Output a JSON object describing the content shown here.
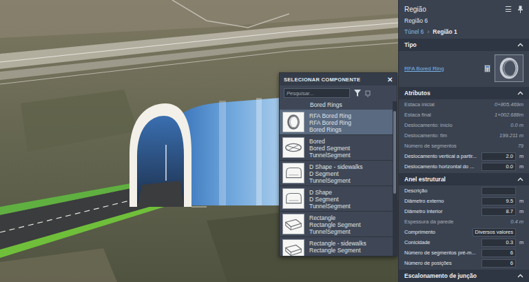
{
  "popup": {
    "title": "SELECIONAR COMPONENTE",
    "close": "✕",
    "search": {
      "placeholder": "Pesquisar..."
    },
    "items": [
      {
        "lines": [
          "Bored Rings"
        ],
        "selected": false,
        "kind": "partial"
      },
      {
        "lines": [
          "RFA Bored Ring",
          "RFA Bored Ring",
          "Bored Rings"
        ],
        "selected": true,
        "kind": "ring"
      },
      {
        "lines": [
          "Bored",
          "Bored Segment",
          "TunnelSegment"
        ],
        "selected": false,
        "kind": "bored"
      },
      {
        "lines": [
          "D Shape - sidewalks",
          "D Segment",
          "TunnelSegment"
        ],
        "selected": false,
        "kind": "dshape"
      },
      {
        "lines": [
          "D Shape",
          "D Segment",
          "TunnelSegment"
        ],
        "selected": false,
        "kind": "dshape"
      },
      {
        "lines": [
          "Rectangle",
          "Rectangle Segment",
          "TunnelSegment"
        ],
        "selected": false,
        "kind": "rect"
      },
      {
        "lines": [
          "Rectangle - sidewalks",
          "Rectangle Segment"
        ],
        "selected": false,
        "kind": "rect"
      }
    ]
  },
  "panel": {
    "title": "Região",
    "menu": "☰",
    "subtitle": "Região 6",
    "breadcrumb": [
      {
        "label": "Túnel 6",
        "selected": false
      },
      {
        "label": "Região 1",
        "selected": true
      }
    ],
    "separator": "›",
    "type_section": {
      "title": "Tipo",
      "expanded": true,
      "link": "RFA Bored Ring"
    },
    "sections": [
      {
        "title": "Atributos",
        "expanded": true,
        "rows": [
          {
            "label": "Estaca inicial",
            "value": "0+805.469m",
            "kind": "readonly"
          },
          {
            "label": "Estaca final",
            "value": "1+002.688m",
            "kind": "readonly"
          },
          {
            "label": "Deslocamento: início",
            "value": "0.0 m",
            "kind": "readonly"
          },
          {
            "label": "Deslocamento: fim",
            "value": "199.211 m",
            "kind": "readonly"
          },
          {
            "label": "Número de segmentos",
            "value": "79",
            "kind": "readonly"
          },
          {
            "label": "Deslocamento vertical a partir...",
            "value": "2.0",
            "unit": "m",
            "kind": "input"
          },
          {
            "label": "Deslocamento horizontal do ...",
            "value": "0.0",
            "unit": "m",
            "kind": "input"
          }
        ]
      },
      {
        "title": "Anel estrutural",
        "expanded": true,
        "rows": [
          {
            "label": "Descrição",
            "value": "",
            "kind": "input"
          },
          {
            "label": "Diâmetro externo",
            "value": "9.5",
            "unit": "m",
            "kind": "input"
          },
          {
            "label": "Diâmetro interior",
            "value": "8.7",
            "unit": "m",
            "kind": "input"
          },
          {
            "label": "Espessura da parede",
            "value": "0.4 m",
            "kind": "readonly"
          },
          {
            "label": "Comprimento",
            "value": "Diversos valores",
            "kind": "input"
          },
          {
            "label": "Conicidade",
            "value": "0.3",
            "unit": "m",
            "kind": "input"
          },
          {
            "label": "Número de segmentos pré-m...",
            "value": "6",
            "kind": "input"
          },
          {
            "label": "Número de posições",
            "value": "6",
            "kind": "input"
          }
        ]
      },
      {
        "title": "Escalonamento de junção",
        "expanded": true,
        "rows": []
      }
    ]
  }
}
